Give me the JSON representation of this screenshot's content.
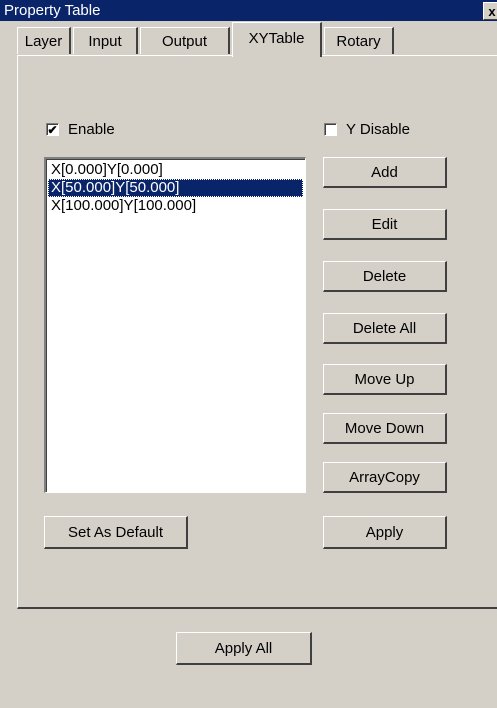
{
  "window": {
    "title": "Property Table",
    "close_glyph": "x"
  },
  "tabs": [
    {
      "label": "Layer"
    },
    {
      "label": "Input"
    },
    {
      "label": "Output"
    },
    {
      "label": "XYTable",
      "active": true
    },
    {
      "label": "Rotary"
    }
  ],
  "enable": {
    "label": "Enable",
    "checked": true,
    "check_glyph": "✔"
  },
  "y_disable": {
    "label": "Y Disable",
    "checked": false
  },
  "list": {
    "items": [
      "X[0.000]Y[0.000]",
      "X[50.000]Y[50.000]",
      "X[100.000]Y[100.000]"
    ],
    "selected_index": 1
  },
  "buttons": {
    "add": "Add",
    "edit": "Edit",
    "delete": "Delete",
    "delete_all": "Delete All",
    "move_up": "Move Up",
    "move_down": "Move Down",
    "array_copy": "ArrayCopy",
    "set_default": "Set As Default",
    "apply": "Apply",
    "apply_all": "Apply All"
  },
  "colors": {
    "face": "#d4d0c8",
    "selection": "#0a246a",
    "titlebar": "#0a246a"
  }
}
